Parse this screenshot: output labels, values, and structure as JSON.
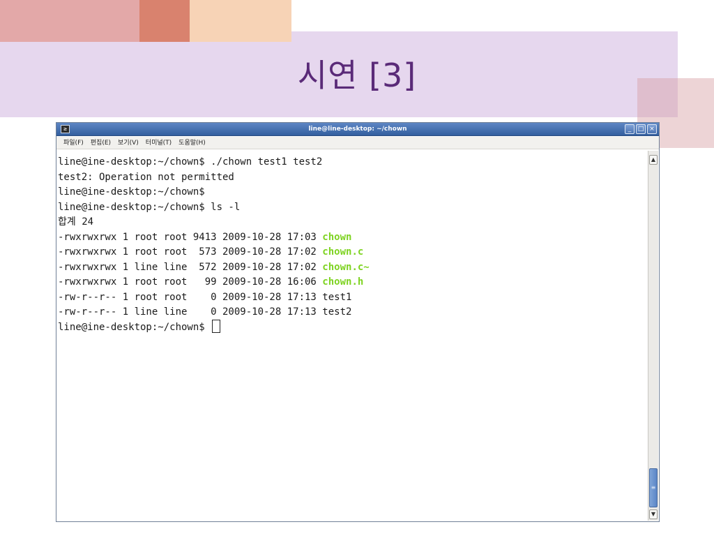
{
  "slide": {
    "title": "시연 [3]"
  },
  "window": {
    "title": "line@line-desktop: ~/chown",
    "app_icon": "terminal-icon",
    "controls": {
      "minimize": "_",
      "maximize": "□",
      "close": "×"
    }
  },
  "menu": [
    "파일(F)",
    "편집(E)",
    "보기(V)",
    "터미널(T)",
    "도움말(H)"
  ],
  "terminal": {
    "lines": [
      "line@ine-desktop:~/chown$ ./chown test1 test2",
      "test2: Operation not permitted",
      "line@ine-desktop:~/chown$",
      "line@ine-desktop:~/chown$ ls -l",
      "합계 24"
    ],
    "listing": [
      {
        "prefix": "-rwxrwxrwx 1 root root 9413 2009-10-28 17:03 ",
        "name": "chown",
        "highlight": true
      },
      {
        "prefix": "-rwxrwxrwx 1 root root  573 2009-10-28 17:02 ",
        "name": "chown.c",
        "highlight": true
      },
      {
        "prefix": "-rwxrwxrwx 1 line line  572 2009-10-28 17:02 ",
        "name": "chown.c~",
        "highlight": true
      },
      {
        "prefix": "-rwxrwxrwx 1 root root   99 2009-10-28 16:06 ",
        "name": "chown.h",
        "highlight": true
      },
      {
        "prefix": "-rw-r--r-- 1 root root    0 2009-10-28 17:13 ",
        "name": "test1",
        "highlight": false
      },
      {
        "prefix": "-rw-r--r-- 1 line line    0 2009-10-28 17:13 ",
        "name": "test2",
        "highlight": false
      }
    ],
    "prompt": "line@ine-desktop:~/chown$"
  },
  "colors": {
    "title": "#5a2a78",
    "highlight_file": "#7ed321",
    "titlebar": "#335f9f"
  },
  "scrollbar": {
    "up": "▲",
    "down": "▼",
    "thumb_grip": "≡",
    "position": 0.88
  }
}
